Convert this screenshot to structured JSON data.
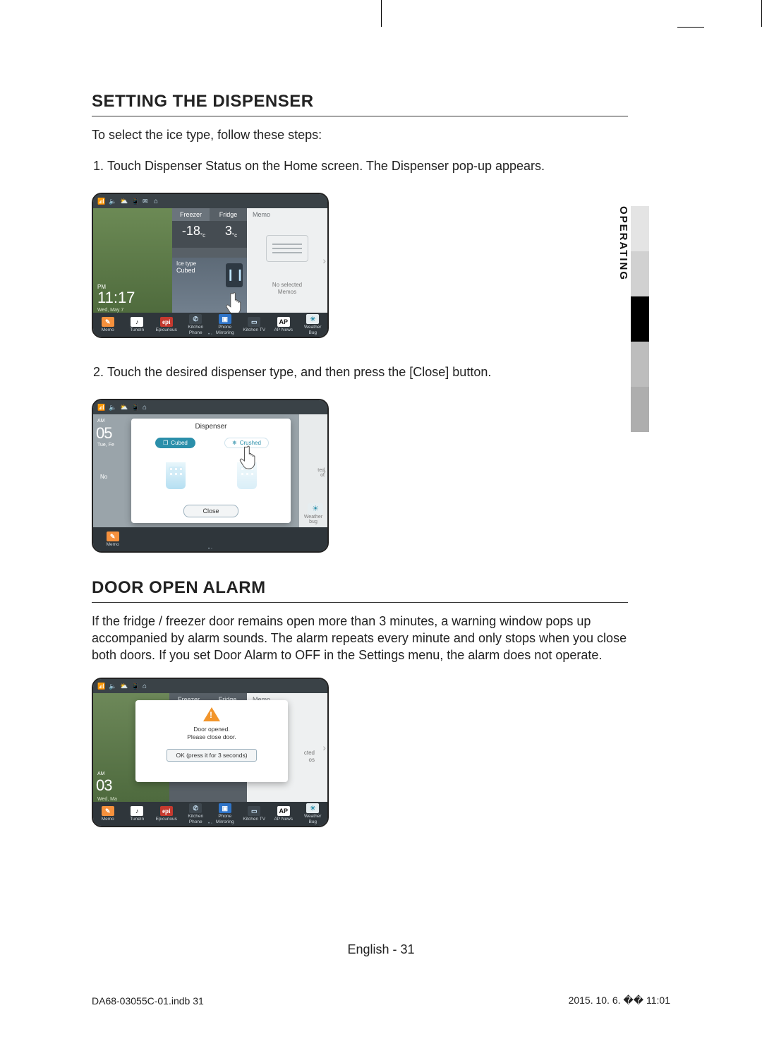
{
  "side_tab": "OPERATING",
  "section1": {
    "heading": "SETTING THE DISPENSER",
    "intro": "To select the ice type, follow these steps:",
    "step1": "Touch Dispenser Status on the Home screen. The Dispenser pop-up appears.",
    "step2": "Touch the desired dispenser type, and then press the [Close] button."
  },
  "section2": {
    "heading": "DOOR OPEN ALARM",
    "body": "If the fridge / freezer door remains open more than 3 minutes, a warning window pops up accompanied by alarm sounds. The alarm repeats every minute and only stops when you close both doors. If you set Door Alarm to OFF in the Settings menu, the alarm does not operate."
  },
  "shot1": {
    "time_ampm": "PM",
    "time": "11:17",
    "date": "Wed, May 7",
    "tab_freezer": "Freezer",
    "tab_fridge": "Fridge",
    "temp_freezer": "-18",
    "temp_freezer_unit": "°c",
    "temp_fridge": "3",
    "temp_fridge_unit": "°c",
    "ice_label_top": "Ice type",
    "ice_label_val": "Cubed",
    "memo_label": "Memo",
    "memo_empty_1": "No selected",
    "memo_empty_2": "Memos"
  },
  "shot2": {
    "time_ampm": "AM",
    "time": "05",
    "date": "Tue, Fe",
    "no_label": "No",
    "popup_title": "Dispenser",
    "opt_cubed": "Cubed",
    "opt_crushed": "Crushed",
    "close": "Close",
    "frag_line1": "ted",
    "frag_line2": "ot",
    "wb": "Weather\nbug"
  },
  "shot3": {
    "time_ampm": "AM",
    "time": "03",
    "date": "Wed, Ma",
    "tab_freezer": "Freezer",
    "tab_fridge": "Fridge",
    "memo_label": "Memo",
    "frag_line1": "cted",
    "frag_line2": "os",
    "popup_line1": "Door opened.",
    "popup_line2": "Please close door.",
    "ok": "OK (press it for 3 seconds)"
  },
  "dock": {
    "i0": "Memo",
    "i1": "TuneIn",
    "i2": "Epicurious",
    "i3a": "Kitchen",
    "i3b": "Phone",
    "i4a": "Phone",
    "i4b": "Mirroring",
    "i5": "Kitchen TV",
    "i6": "AP News",
    "i7a": "Weather",
    "i7b": "Bug",
    "ap": "AP",
    "epi": "epi"
  },
  "footer": {
    "center": "English - 31",
    "left": "DA68-03055C-01.indb   31",
    "right": "2015. 10. 6.   �� 11:01"
  }
}
